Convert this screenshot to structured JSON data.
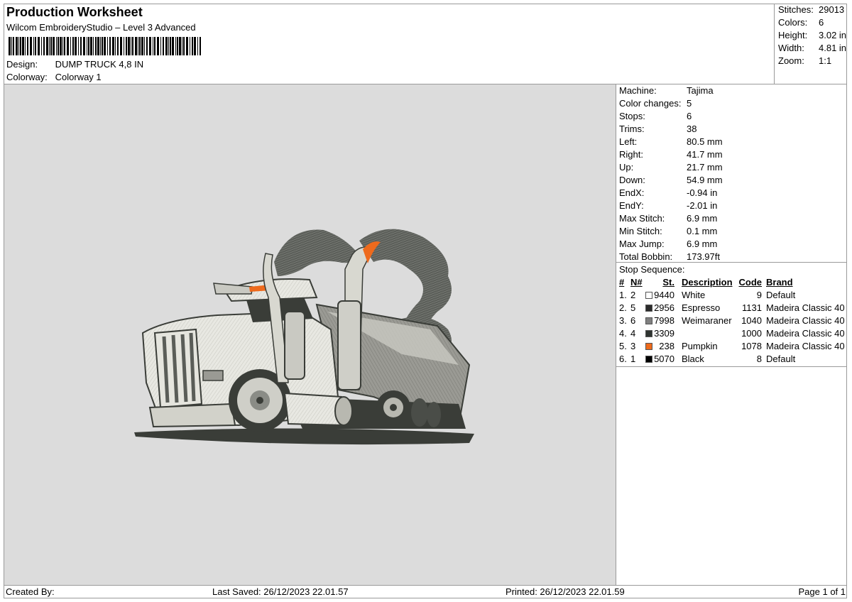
{
  "header": {
    "title": "Production Worksheet",
    "subtitle": "Wilcom EmbroideryStudio – Level 3 Advanced",
    "design_label": "Design:",
    "design_value": "DUMP TRUCK 4,8 IN",
    "colorway_label": "Colorway:",
    "colorway_value": "Colorway 1"
  },
  "summary": [
    {
      "label": "Stitches:",
      "value": "29013"
    },
    {
      "label": "Colors:",
      "value": "6"
    },
    {
      "label": "Height:",
      "value": "3.02 in"
    },
    {
      "label": "Width:",
      "value": "4.81 in"
    },
    {
      "label": "Zoom:",
      "value": "1:1"
    }
  ],
  "machine_info": [
    {
      "label": "Machine:",
      "value": "Tajima"
    },
    {
      "label": "Color changes:",
      "value": "5"
    },
    {
      "label": "Stops:",
      "value": "6"
    },
    {
      "label": "Trims:",
      "value": "38"
    },
    {
      "label": "Left:",
      "value": "80.5 mm"
    },
    {
      "label": "Right:",
      "value": "41.7 mm"
    },
    {
      "label": "Up:",
      "value": "21.7 mm"
    },
    {
      "label": "Down:",
      "value": "54.9 mm"
    },
    {
      "label": "EndX:",
      "value": "-0.94 in"
    },
    {
      "label": "EndY:",
      "value": "-2.01 in"
    },
    {
      "label": "Max Stitch:",
      "value": "6.9 mm"
    },
    {
      "label": "Min Stitch:",
      "value": "0.1 mm"
    },
    {
      "label": "Max Jump:",
      "value": "6.9 mm"
    },
    {
      "label": "Total Bobbin:",
      "value": "173.97ft"
    }
  ],
  "stop_sequence": {
    "caption": "Stop Sequence:",
    "headers": {
      "num": "#",
      "n": "N#",
      "st": "St.",
      "description": "Description",
      "code": "Code",
      "brand": "Brand"
    },
    "rows": [
      {
        "num": "1.",
        "n": "2",
        "color": "#ffffff",
        "st": "9440",
        "description": "White",
        "code": "9",
        "brand": "Default"
      },
      {
        "num": "2.",
        "n": "5",
        "color": "#2b2b2b",
        "st": "2956",
        "description": "Espresso",
        "code": "1131",
        "brand": "Madeira Classic 40"
      },
      {
        "num": "3.",
        "n": "6",
        "color": "#808080",
        "st": "7998",
        "description": "Weimaraner",
        "code": "1040",
        "brand": "Madeira Classic 40"
      },
      {
        "num": "4.",
        "n": "4",
        "color": "#2f3431",
        "st": "3309",
        "description": "",
        "code": "1000",
        "brand": "Madeira Classic 40"
      },
      {
        "num": "5.",
        "n": "3",
        "color": "#ee6a1c",
        "st": "238",
        "description": "Pumpkin",
        "code": "1078",
        "brand": "Madeira Classic 40"
      },
      {
        "num": "6.",
        "n": "1",
        "color": "#000000",
        "st": "5070",
        "description": "Black",
        "code": "8",
        "brand": "Default"
      }
    ]
  },
  "footer": {
    "created_by": "Created By:",
    "last_saved": "Last Saved: 26/12/2023 22.01.57",
    "printed": "Printed: 26/12/2023 22.01.59",
    "page": "Page 1 of 1"
  }
}
